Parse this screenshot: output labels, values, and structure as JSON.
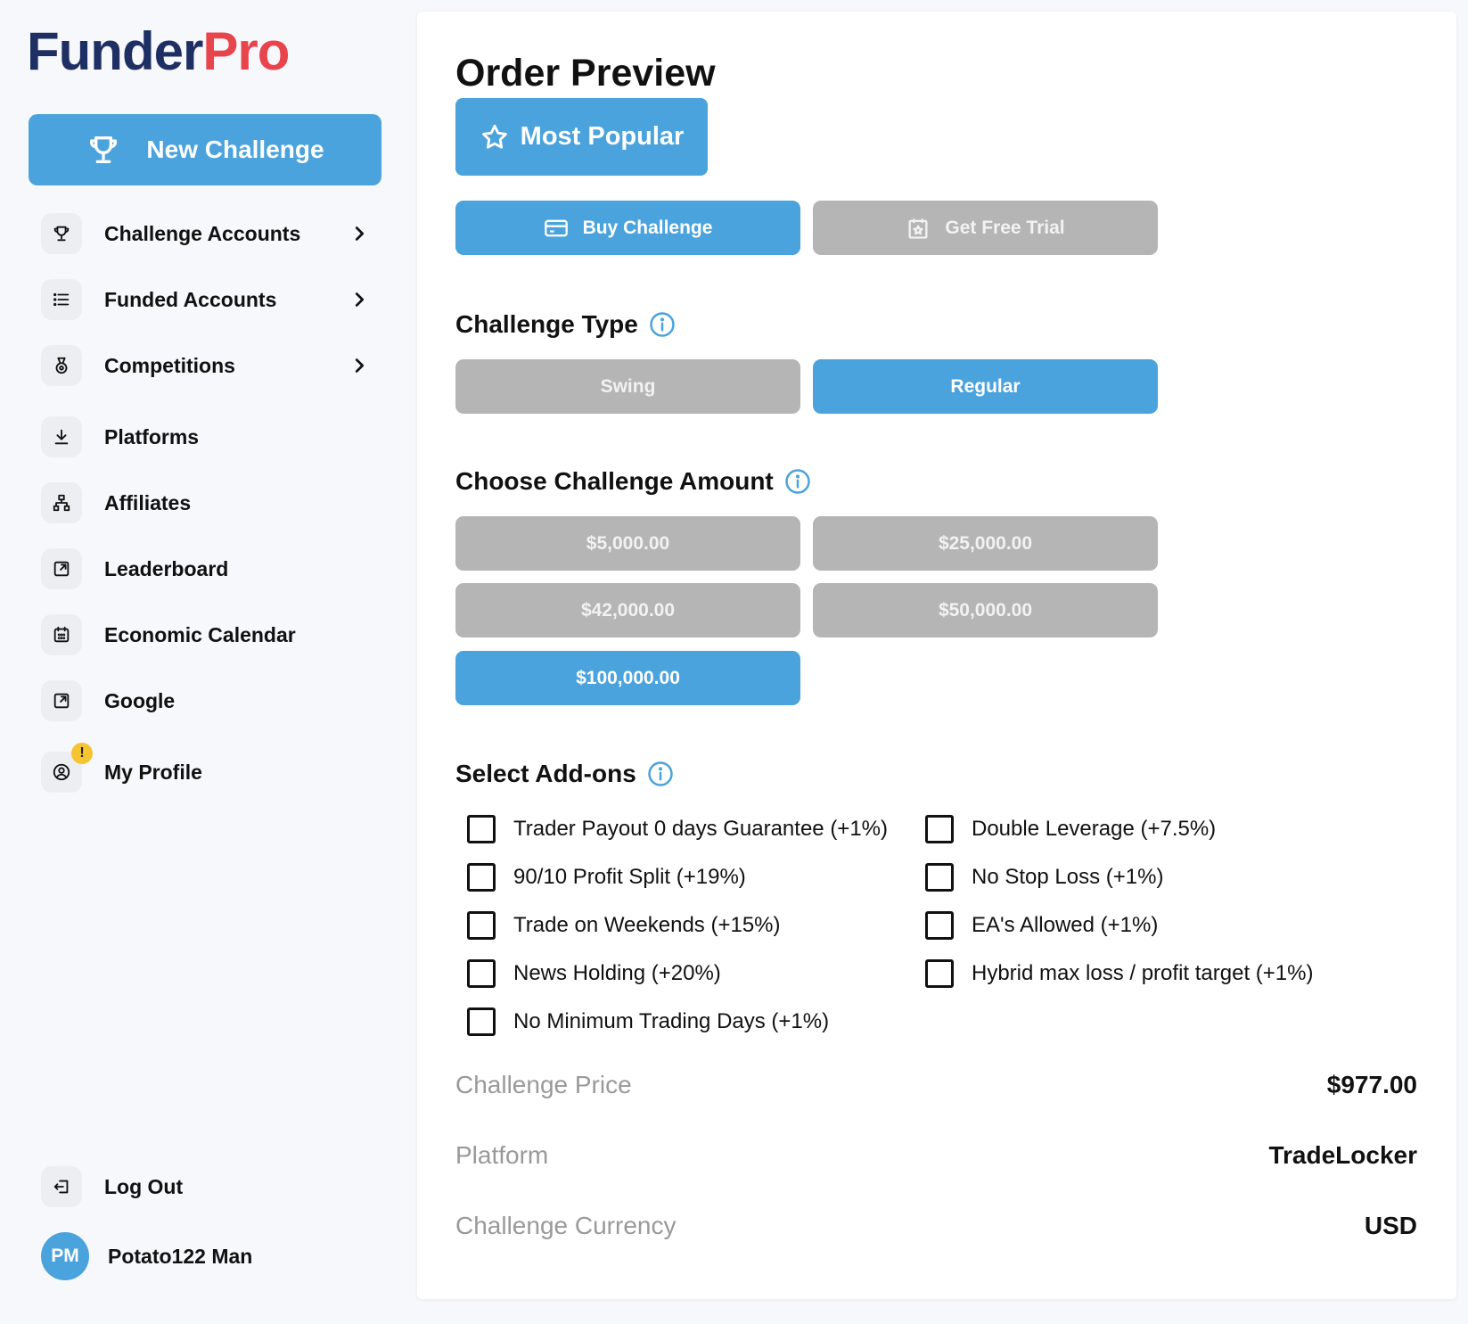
{
  "brand": {
    "part1": "Funder",
    "part2": "Pro"
  },
  "sidebar": {
    "new_challenge": "New Challenge",
    "items": [
      {
        "label": "Challenge Accounts",
        "icon": "trophy-icon"
      },
      {
        "label": "Funded Accounts",
        "icon": "list-icon"
      },
      {
        "label": "Competitions",
        "icon": "medal-icon"
      },
      {
        "label": "Platforms",
        "icon": "download-icon"
      },
      {
        "label": "Affiliates",
        "icon": "network-icon"
      },
      {
        "label": "Leaderboard",
        "icon": "external-link-icon"
      },
      {
        "label": "Economic Calendar",
        "icon": "calendar-icon"
      },
      {
        "label": "Google",
        "icon": "external-link-icon"
      },
      {
        "label": "My Profile",
        "icon": "user-icon",
        "badge": "!"
      }
    ],
    "logout": "Log Out",
    "user": {
      "initials": "PM",
      "name": "Potato122 Man"
    }
  },
  "main": {
    "title": "Order Preview",
    "most_popular": "Most Popular",
    "mode_buttons": {
      "buy": "Buy Challenge",
      "trial": "Get Free Trial",
      "selected": "buy"
    },
    "challenge_type": {
      "title": "Challenge Type",
      "options": [
        "Swing",
        "Regular"
      ],
      "selected": "Regular"
    },
    "amount": {
      "title": "Choose Challenge Amount",
      "options": [
        "$5,000.00",
        "$25,000.00",
        "$42,000.00",
        "$50,000.00",
        "$100,000.00"
      ],
      "selected": "$100,000.00"
    },
    "addons": {
      "title": "Select Add-ons",
      "left": [
        "Trader Payout 0 days Guarantee (+1%)",
        "90/10 Profit Split (+19%)",
        "Trade on Weekends (+15%)",
        "News Holding (+20%)",
        "No Minimum Trading Days (+1%)"
      ],
      "right": [
        "Double Leverage (+7.5%)",
        "No Stop Loss (+1%)",
        "EA's Allowed (+1%)",
        "Hybrid max loss / profit target (+1%)"
      ]
    },
    "summary": {
      "price_label": "Challenge Price",
      "price_value": "$977.00",
      "platform_label": "Platform",
      "platform_value": "TradeLocker",
      "currency_label": "Challenge Currency",
      "currency_value": "USD"
    }
  },
  "colors": {
    "accent": "#4aa3dc",
    "inactive": "#b5b5b5",
    "brand_navy": "#1e2f63",
    "brand_red": "#e8444b"
  }
}
